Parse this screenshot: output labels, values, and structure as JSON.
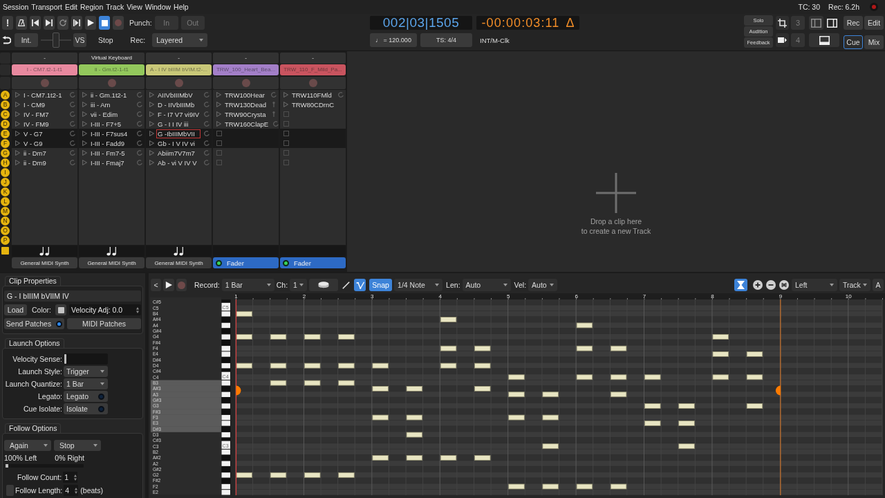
{
  "menu": [
    "Session",
    "Transport",
    "Edit",
    "Region",
    "Track",
    "View",
    "Window",
    "Help"
  ],
  "status": {
    "timecode": "TC: 30",
    "record_time": "Rec: 6.2h"
  },
  "transport": {
    "buttons": [
      {
        "kind": "text",
        "label": "!",
        "active": false
      },
      {
        "kind": "metronome",
        "active": false
      },
      {
        "kind": "to-start",
        "active": false
      },
      {
        "kind": "to-end",
        "active": false
      },
      {
        "kind": "loop",
        "active": false
      },
      {
        "kind": "play-range",
        "active": false
      },
      {
        "kind": "play",
        "active": false
      },
      {
        "kind": "stop",
        "active": true
      },
      {
        "kind": "record",
        "active": false
      }
    ],
    "punch_label": "Punch:",
    "punch": [
      "In",
      "Out"
    ],
    "sync": "Int.",
    "shuttle": {
      "level": 0.5
    },
    "varispeed": "VS",
    "shuttle_mode": "Stop",
    "rec_label": "Rec:",
    "rec_mode": "Layered"
  },
  "clocks": {
    "bbt": "002|03|1505",
    "timecode": "-00:00:03:11",
    "delta": "Δ",
    "tempo": "♩ = 120.000",
    "meter": "TS: 4/4",
    "sync_source": "INT/M-Clk"
  },
  "monitor": [
    "Solo",
    "Audition",
    "Feedback"
  ],
  "nudge": [
    {
      "kind": "crop",
      "label": "3"
    },
    {
      "kind": "insert",
      "label": "4"
    }
  ],
  "pages": [
    {
      "label": "Rec",
      "selected": false
    },
    {
      "label": "Edit",
      "selected": false
    },
    {
      "label": "Cue",
      "selected": true
    },
    {
      "label": "Mix",
      "selected": false
    }
  ],
  "cue": {
    "scenes": [
      {
        "letter": "A",
        "highlighted": false
      },
      {
        "letter": "B",
        "highlighted": false
      },
      {
        "letter": "C",
        "highlighted": false
      },
      {
        "letter": "D",
        "highlighted": false
      },
      {
        "letter": "E",
        "highlighted": true
      },
      {
        "letter": "F",
        "highlighted": true
      },
      {
        "letter": "G",
        "highlighted": false
      },
      {
        "letter": "H",
        "highlighted": false
      },
      {
        "letter": "I",
        "highlighted": false
      },
      {
        "letter": "J",
        "highlighted": false
      },
      {
        "letter": "K",
        "highlighted": false
      },
      {
        "letter": "L",
        "highlighted": false
      },
      {
        "letter": "M",
        "highlighted": false
      },
      {
        "letter": "N",
        "highlighted": false
      },
      {
        "letter": "O",
        "highlighted": false
      },
      {
        "letter": "P",
        "highlighted": false
      }
    ],
    "tracks": [
      {
        "name": "-",
        "clip": "I - CM7.t2-1-t1",
        "color": "#e8899f",
        "midi": true,
        "output": {
          "kind": "synth",
          "label": "General MIDI Synth"
        },
        "slots": [
          {
            "kind": "loop",
            "label": "I - CM7.1t2-1",
            "selected": false
          },
          {
            "kind": "loop",
            "label": "I - CM9",
            "selected": false
          },
          {
            "kind": "loop",
            "label": "IV - FM7",
            "selected": false
          },
          {
            "kind": "loop",
            "label": "IV - FM9",
            "selected": false
          },
          {
            "kind": "loop",
            "label": "V - G7",
            "selected": false
          },
          {
            "kind": "loop",
            "label": "V - G9",
            "selected": false
          },
          {
            "kind": "loop",
            "label": "ii - Dm7",
            "selected": false
          },
          {
            "kind": "loop",
            "label": "ii - Dm9",
            "selected": false
          }
        ]
      },
      {
        "name": "Virtual Keyboard",
        "clip": "ii - Gm.t2-1-t1",
        "color": "#93c85c",
        "midi": true,
        "output": {
          "kind": "synth",
          "label": "General MIDI Synth"
        },
        "slots": [
          {
            "kind": "loop",
            "label": "ii - Gm.1t2-1",
            "selected": false
          },
          {
            "kind": "loop",
            "label": "iii - Am",
            "selected": false
          },
          {
            "kind": "loop",
            "label": "vii - Edim",
            "selected": false
          },
          {
            "kind": "loop",
            "label": "I-III - F7+5",
            "selected": false
          },
          {
            "kind": "loop",
            "label": "I-III - F7sus4",
            "selected": false
          },
          {
            "kind": "loop",
            "label": "I-III - Fadd9",
            "selected": false
          },
          {
            "kind": "loop",
            "label": "I-III - Fm7-5",
            "selected": false
          },
          {
            "kind": "loop",
            "label": "I-III - Fmaj7",
            "selected": false
          }
        ]
      },
      {
        "name": "-",
        "clip": "A - I IV bIIIM bVIM.t2-...",
        "color": "#c9c878",
        "midi": true,
        "output": {
          "kind": "synth",
          "label": "General MIDI Synth"
        },
        "slots": [
          {
            "kind": "loop",
            "label": "AIIVbIIIMbV",
            "selected": false
          },
          {
            "kind": "loop",
            "label": "D - IIVbIIIMb",
            "selected": false
          },
          {
            "kind": "loop",
            "label": "F - I7 V7 vi9IV",
            "selected": false
          },
          {
            "kind": "loop",
            "label": "G - I I IV iii",
            "selected": false
          },
          {
            "kind": "loop",
            "label": "G -IbIIIMbVII",
            "selected": true
          },
          {
            "kind": "loop",
            "label": "Gb - I V IV vi",
            "selected": false
          },
          {
            "kind": "loop",
            "label": "Abiim7V7m7",
            "selected": false
          },
          {
            "kind": "loop",
            "label": "Ab - vi V IV V",
            "selected": false
          }
        ]
      },
      {
        "name": "-",
        "clip": "TRW_100_Heart_Bea...",
        "color": "#a37fc8",
        "midi": false,
        "output": {
          "kind": "fader",
          "label": "Fader"
        },
        "slots": [
          {
            "kind": "loop",
            "label": "TRW100Hear",
            "selected": false
          },
          {
            "kind": "stop",
            "label": "TRW130Dead",
            "selected": false
          },
          {
            "kind": "stop",
            "label": "TRW90Crysta",
            "selected": false
          },
          {
            "kind": "loop",
            "label": "TRW160ClapE",
            "selected": false
          },
          {
            "kind": "empty"
          },
          {
            "kind": "empty"
          },
          {
            "kind": "empty"
          },
          {
            "kind": "empty"
          }
        ]
      },
      {
        "name": "-",
        "clip": "TRW_110_F_Mild_Pa...",
        "color": "#c9545f",
        "midi": false,
        "output": {
          "kind": "fader",
          "label": "Fader"
        },
        "slots": [
          {
            "kind": "loop",
            "label": "TRW110FMld",
            "selected": false
          },
          {
            "kind": "plain",
            "label": "TRW80CDrnC",
            "selected": false
          },
          {
            "kind": "empty"
          },
          {
            "kind": "empty"
          },
          {
            "kind": "empty"
          },
          {
            "kind": "empty"
          },
          {
            "kind": "empty"
          },
          {
            "kind": "empty"
          }
        ]
      }
    ],
    "drop_hint": [
      "Drop a clip here",
      "to create a new Track"
    ]
  },
  "clip_properties": {
    "title": "Clip Properties",
    "name": "G - I bIIIM bVIIM IV",
    "load": "Load",
    "color_label": "Color:",
    "color": "#c4c4c4",
    "velocity_adj": "Velocity Adj: 0.0",
    "send_patches": {
      "label": "Send Patches",
      "on": true
    },
    "midi_patches": "MIDI Patches"
  },
  "launch_options": {
    "title": "Launch Options",
    "rows": [
      {
        "kind": "slider",
        "label": "Velocity Sense:",
        "level": 0
      },
      {
        "kind": "dropdown",
        "label": "Launch Style:",
        "value": "Trigger"
      },
      {
        "kind": "dropdown",
        "label": "Launch Quantize:",
        "value": "1 Bar"
      },
      {
        "kind": "toggle",
        "label": "Legato:",
        "value": "Legato",
        "on": false
      },
      {
        "kind": "toggle",
        "label": "Cue Isolate:",
        "value": "Isolate",
        "on": false
      }
    ]
  },
  "follow_options": {
    "title": "Follow Options",
    "actions": [
      "Again",
      "Stop"
    ],
    "shares": [
      "100% Left",
      "0% Right"
    ],
    "balance": {
      "level": 0
    },
    "count_label": "Follow Count:",
    "count": "1",
    "length_checked": false,
    "length_label": "Follow Length:",
    "length": "4",
    "length_unit": "(beats)"
  },
  "editor": {
    "toolbar": {
      "back": "<",
      "record_label": "Record:",
      "record_length": "1 Bar",
      "channel_label": "Ch:",
      "channel": "1",
      "tools": [
        {
          "kind": "pencil",
          "selected": false
        },
        {
          "kind": "check",
          "selected": true
        }
      ],
      "snap": {
        "label": "Snap",
        "on": true
      },
      "grid": "1/4 Note",
      "length_label": "Len:",
      "length": "Auto",
      "velocity_label": "Vel:",
      "velocity": "Auto",
      "icon_toggle": {
        "on": true
      },
      "dropdowns": [
        "Left",
        "Track"
      ],
      "end_button": "A"
    },
    "keys": [
      {
        "kind": "black",
        "highlighted": false
      },
      {
        "kind": "white",
        "key_label": "C5",
        "highlighted": false
      },
      {
        "kind": "white",
        "highlighted": false
      },
      {
        "kind": "black",
        "highlighted": false
      },
      {
        "kind": "white",
        "highlighted": false
      },
      {
        "kind": "black",
        "highlighted": false
      },
      {
        "kind": "white",
        "highlighted": false
      },
      {
        "kind": "black",
        "highlighted": false
      },
      {
        "kind": "white",
        "highlighted": false
      },
      {
        "kind": "white",
        "highlighted": false
      },
      {
        "kind": "black",
        "highlighted": false
      },
      {
        "kind": "white",
        "highlighted": false
      },
      {
        "kind": "black",
        "highlighted": false
      },
      {
        "kind": "white",
        "key_label": "C4",
        "highlighted": false
      },
      {
        "kind": "white",
        "highlighted": true
      },
      {
        "kind": "black",
        "highlighted": true
      },
      {
        "kind": "white",
        "highlighted": true
      },
      {
        "kind": "black",
        "highlighted": true
      },
      {
        "kind": "white",
        "highlighted": true
      },
      {
        "kind": "black",
        "highlighted": true
      },
      {
        "kind": "white",
        "highlighted": true
      },
      {
        "kind": "white",
        "highlighted": true
      },
      {
        "kind": "black",
        "highlighted": true
      },
      {
        "kind": "white",
        "highlighted": false
      },
      {
        "kind": "black",
        "highlighted": false
      },
      {
        "kind": "white",
        "key_label": "C3",
        "highlighted": false
      },
      {
        "kind": "white",
        "highlighted": false
      },
      {
        "kind": "black",
        "highlighted": false
      },
      {
        "kind": "white",
        "highlighted": false
      },
      {
        "kind": "black",
        "highlighted": false
      },
      {
        "kind": "white",
        "highlighted": false
      },
      {
        "kind": "black",
        "highlighted": false
      },
      {
        "kind": "white",
        "highlighted": false
      },
      {
        "kind": "white",
        "highlighted": false
      }
    ],
    "chart_data": {
      "type": "scatter",
      "orientation": "horizontal",
      "grid": true,
      "xlim": [
        1,
        10.5
      ],
      "xticks": [
        {
          "value": 1,
          "label": "1"
        },
        {
          "value": 2,
          "label": "2"
        },
        {
          "value": 3,
          "label": "3"
        },
        {
          "value": 4,
          "label": "4"
        },
        {
          "value": 5,
          "label": "5"
        },
        {
          "value": 6,
          "label": "6"
        },
        {
          "value": 7,
          "label": "7"
        },
        {
          "value": 8,
          "label": "8"
        },
        {
          "value": 9,
          "label": "9"
        },
        {
          "value": 10,
          "label": "10"
        }
      ],
      "categories": [
        "C#5",
        "C5",
        "B4",
        "A#4",
        "A4",
        "G#4",
        "G4",
        "F#4",
        "F4",
        "E4",
        "D#4",
        "D4",
        "C#4",
        "C4",
        "B3",
        "A#3",
        "A3",
        "G#3",
        "G3",
        "F#3",
        "F3",
        "E3",
        "D#3",
        "D3",
        "C#3",
        "C3",
        "B2",
        "A#2",
        "A2",
        "G#2",
        "G2",
        "F#2",
        "F2",
        "E2"
      ],
      "series": [
        {
          "color": "#e8e5c2",
          "values": [
            null,
            null,
            1.125,
            4.125,
            6.125,
            null,
            1.125,
            null,
            4.125,
            8.125,
            null,
            1.125,
            null,
            5.125,
            1.625,
            3.125,
            5.125,
            null,
            7.125,
            null,
            3.125,
            7.125,
            null,
            3.625,
            null,
            5.625,
            null,
            3.125,
            null,
            null,
            1.125,
            null,
            5.125,
            null
          ]
        },
        {
          "color": "#e8e5c2",
          "values": [
            null,
            null,
            null,
            null,
            null,
            null,
            1.625,
            null,
            4.625,
            8.625,
            null,
            1.625,
            null,
            6.125,
            2.125,
            3.625,
            5.625,
            null,
            7.625,
            null,
            3.625,
            7.625,
            null,
            null,
            null,
            7.625,
            null,
            3.625,
            null,
            null,
            1.625,
            null,
            5.625,
            null
          ]
        },
        {
          "color": "#e8e5c2",
          "values": [
            null,
            null,
            null,
            null,
            null,
            null,
            2.125,
            null,
            6.125,
            null,
            null,
            2.125,
            null,
            6.625,
            2.625,
            4.625,
            6.625,
            null,
            8.625,
            null,
            5.125,
            null,
            null,
            null,
            null,
            null,
            null,
            4.125,
            null,
            null,
            2.125,
            null,
            6.125,
            null
          ]
        },
        {
          "color": "#e8e5c2",
          "values": [
            null,
            null,
            null,
            null,
            null,
            null,
            2.625,
            null,
            6.625,
            null,
            null,
            2.625,
            null,
            7.125,
            null,
            null,
            null,
            null,
            null,
            null,
            5.625,
            null,
            null,
            null,
            null,
            null,
            null,
            4.625,
            null,
            null,
            2.625,
            null,
            6.625,
            null
          ]
        },
        {
          "color": "#e8e5c2",
          "values": [
            null,
            null,
            null,
            null,
            null,
            null,
            8.125,
            null,
            null,
            null,
            null,
            3.125,
            null,
            8.125,
            null,
            null,
            null,
            null,
            null,
            null,
            null,
            null,
            null,
            null,
            null,
            null,
            null,
            null,
            null,
            null,
            null,
            null,
            null,
            null
          ]
        },
        {
          "color": "#e8e5c2",
          "values": [
            null,
            null,
            null,
            null,
            null,
            null,
            null,
            null,
            null,
            null,
            null,
            4.125,
            null,
            8.625,
            null,
            null,
            null,
            null,
            null,
            null,
            null,
            null,
            null,
            null,
            null,
            null,
            null,
            null,
            null,
            null,
            null,
            null,
            null,
            null
          ]
        },
        {
          "color": "#e8e5c2",
          "values": [
            null,
            null,
            null,
            null,
            null,
            null,
            null,
            null,
            null,
            null,
            null,
            4.625,
            null,
            null,
            null,
            null,
            null,
            null,
            null,
            null,
            null,
            null,
            null,
            null,
            null,
            null,
            null,
            null,
            null,
            null,
            null,
            null,
            null,
            null
          ]
        }
      ],
      "ref_lines": [
        {
          "axis": "x",
          "value": 1,
          "color": "#d43c3c"
        },
        {
          "axis": "x",
          "value": 9,
          "color": "#c8702a"
        }
      ]
    }
  }
}
